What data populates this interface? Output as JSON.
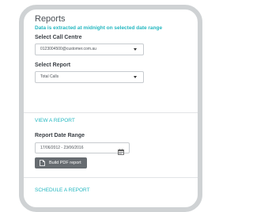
{
  "reports": {
    "title": "Reports",
    "notice": "Data is extracted at midnight on selected date range",
    "call_centre_label": "Select Call Centre",
    "call_centre_value": "0123004500@customer.com.au",
    "report_label": "Select Report",
    "report_value": "Total Calls"
  },
  "view_report": {
    "link": "VIEW A REPORT",
    "date_range_label": "Report Date Range",
    "date_range_value": "17/06/2012 - 23/06/2016",
    "build_pdf_label": "Build PDF report"
  },
  "schedule_report": {
    "link": "SCHEDULE A REPORT"
  },
  "icons": {
    "select_caret": "chevron-down-icon",
    "calendar": "calendar-icon",
    "pdf": "document-icon"
  },
  "colors": {
    "accent": "#23b7c0",
    "button": "#666b70",
    "frame": "#cfd2d4"
  }
}
